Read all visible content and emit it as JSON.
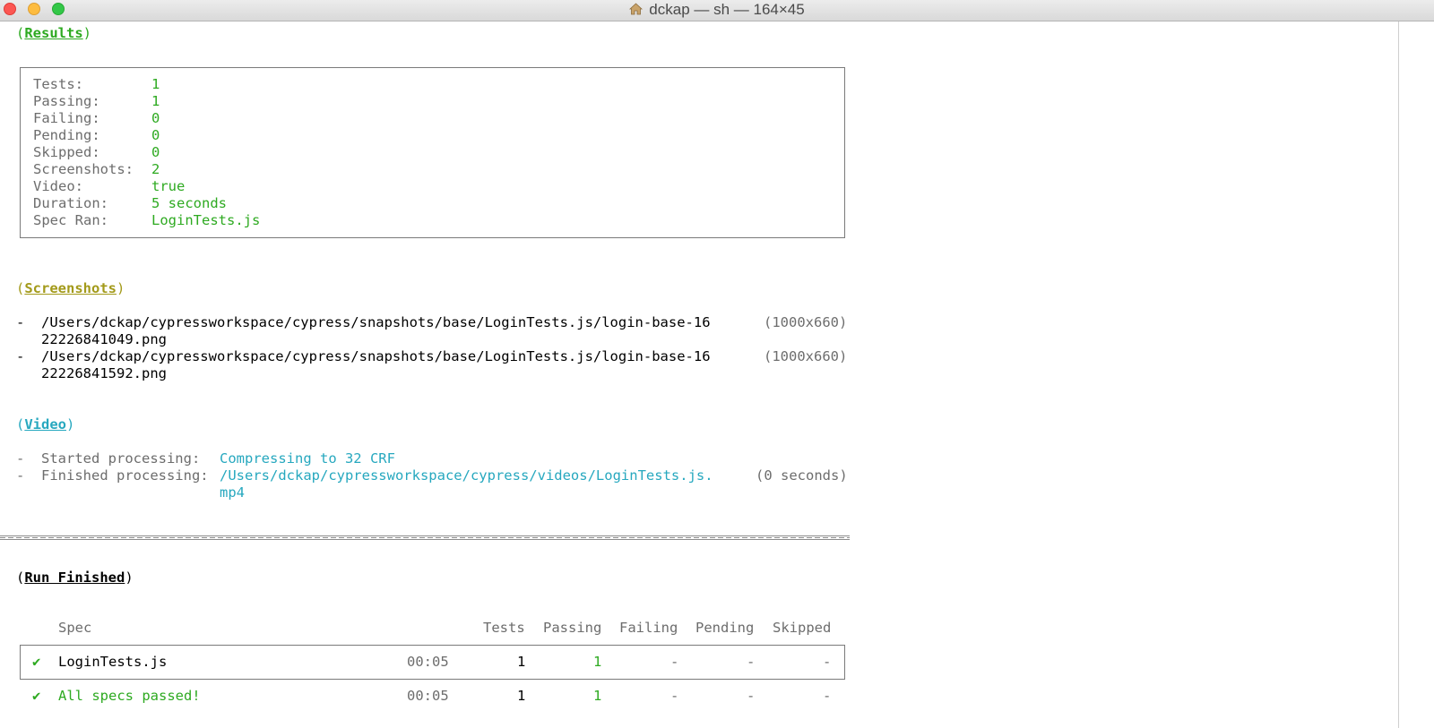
{
  "window": {
    "title": "dckap — sh — 164×45"
  },
  "results": {
    "heading": "Results",
    "rows": [
      {
        "label": "Tests:",
        "value": "1"
      },
      {
        "label": "Passing:",
        "value": "1"
      },
      {
        "label": "Failing:",
        "value": "0"
      },
      {
        "label": "Pending:",
        "value": "0"
      },
      {
        "label": "Skipped:",
        "value": "0"
      },
      {
        "label": "Screenshots:",
        "value": "2"
      },
      {
        "label": "Video:",
        "value": "true"
      },
      {
        "label": "Duration:",
        "value": "5 seconds"
      },
      {
        "label": "Spec Ran:",
        "value": "LoginTests.js"
      }
    ]
  },
  "screenshots": {
    "heading": "Screenshots",
    "items": [
      {
        "path_line1": "/Users/dckap/cypressworkspace/cypress/snapshots/base/LoginTests.js/login-base-16",
        "path_line2": "22226841049.png",
        "size": "(1000x660)"
      },
      {
        "path_line1": "/Users/dckap/cypressworkspace/cypress/snapshots/base/LoginTests.js/login-base-16",
        "path_line2": "22226841592.png",
        "size": "(1000x660)"
      }
    ]
  },
  "video": {
    "heading": "Video",
    "started_label": "Started processing:",
    "started_value": "Compressing to 32 CRF",
    "finished_label": "Finished processing:",
    "finished_value_line1": "/Users/dckap/cypressworkspace/cypress/videos/LoginTests.js.",
    "finished_value_line2": "mp4",
    "finished_time": "(0 seconds)"
  },
  "run_finished": {
    "heading": "Run Finished",
    "columns": [
      "Spec",
      "Tests",
      "Passing",
      "Failing",
      "Pending",
      "Skipped"
    ],
    "rows": [
      {
        "check": "✔",
        "spec": "LoginTests.js",
        "time": "00:05",
        "tests": "1",
        "passing": "1",
        "failing": "-",
        "pending": "-",
        "skipped": "-"
      }
    ],
    "summary": {
      "check": "✔",
      "spec": "All specs passed!",
      "time": "00:05",
      "tests": "1",
      "passing": "1",
      "failing": "-",
      "pending": "-",
      "skipped": "-"
    }
  },
  "colors": {
    "green": "#2eaa21",
    "cyan": "#27a8bf",
    "olive": "#a39a1a",
    "gray": "#6d6d6d"
  }
}
